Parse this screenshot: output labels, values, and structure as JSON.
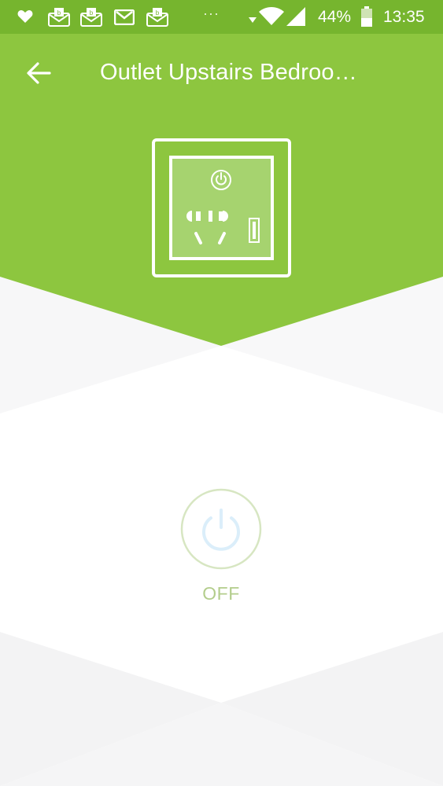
{
  "status_bar": {
    "notification_icons": [
      "heart-icon",
      "mail-inbox-icon",
      "mail-inbox-icon",
      "gmail-icon",
      "mail-inbox-icon"
    ],
    "overflow_dots": "···",
    "battery_percent": "44%",
    "time": "13:35"
  },
  "app_bar": {
    "title": "Outlet Upstairs Bedroo…"
  },
  "device": {
    "state_label": "OFF"
  },
  "colors": {
    "header_green": "#8dc63f",
    "status_green": "#76b52e",
    "power_ring": "#d7e6c2",
    "power_icon_off": "#dbeefa",
    "state_text": "#b3cd8c"
  }
}
